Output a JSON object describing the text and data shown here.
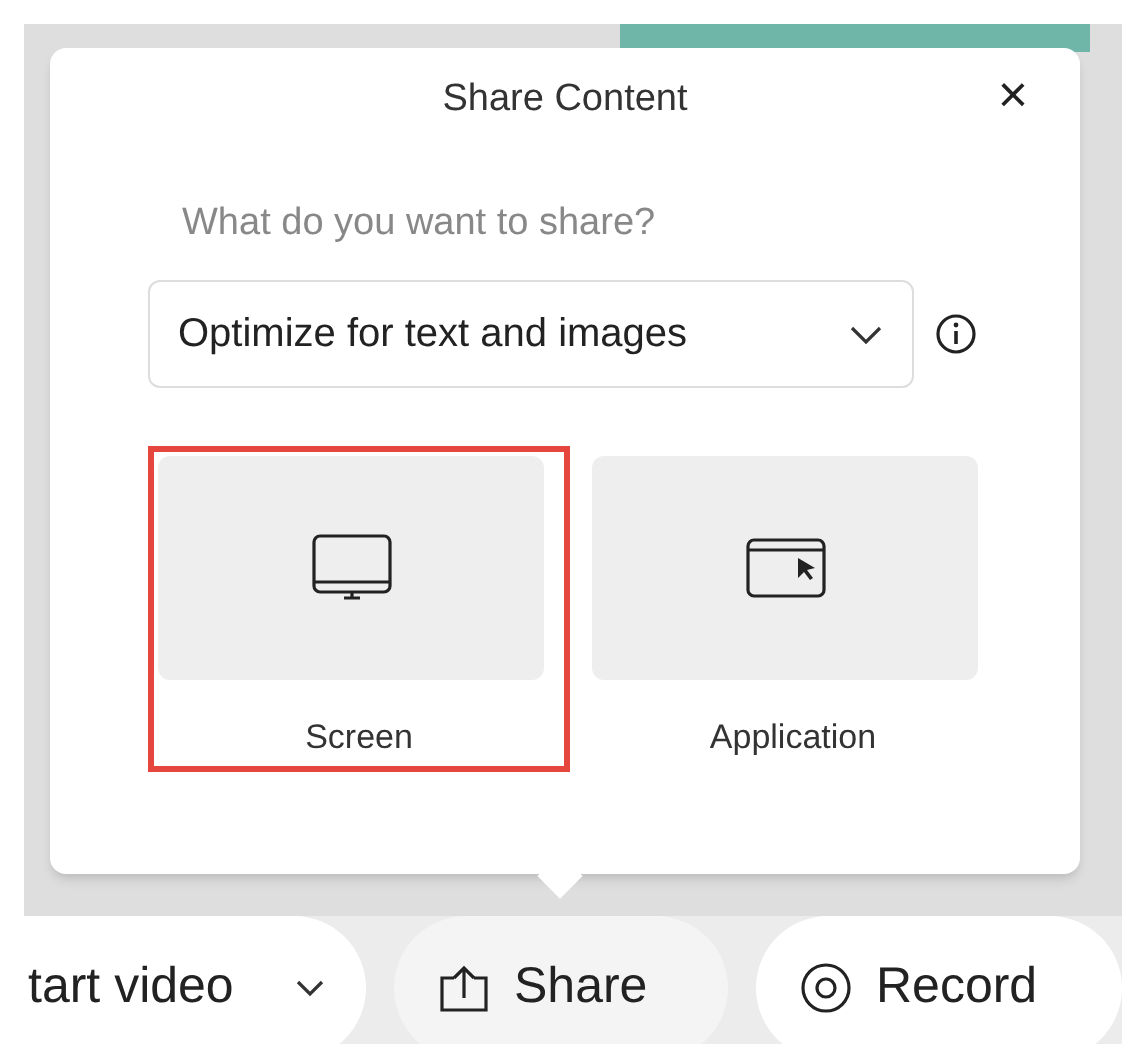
{
  "dialog": {
    "title": "Share Content",
    "close": "×",
    "question": "What do you want to share?",
    "dropdown": {
      "value": "Optimize for text and images"
    },
    "options": [
      {
        "kind": "screen",
        "label": "Screen",
        "selected": true
      },
      {
        "kind": "application",
        "label": "Application",
        "selected": false
      }
    ]
  },
  "toolbar": [
    {
      "kind": "video",
      "label": "tart video"
    },
    {
      "kind": "share",
      "label": "Share"
    },
    {
      "kind": "record",
      "label": "Record"
    }
  ]
}
